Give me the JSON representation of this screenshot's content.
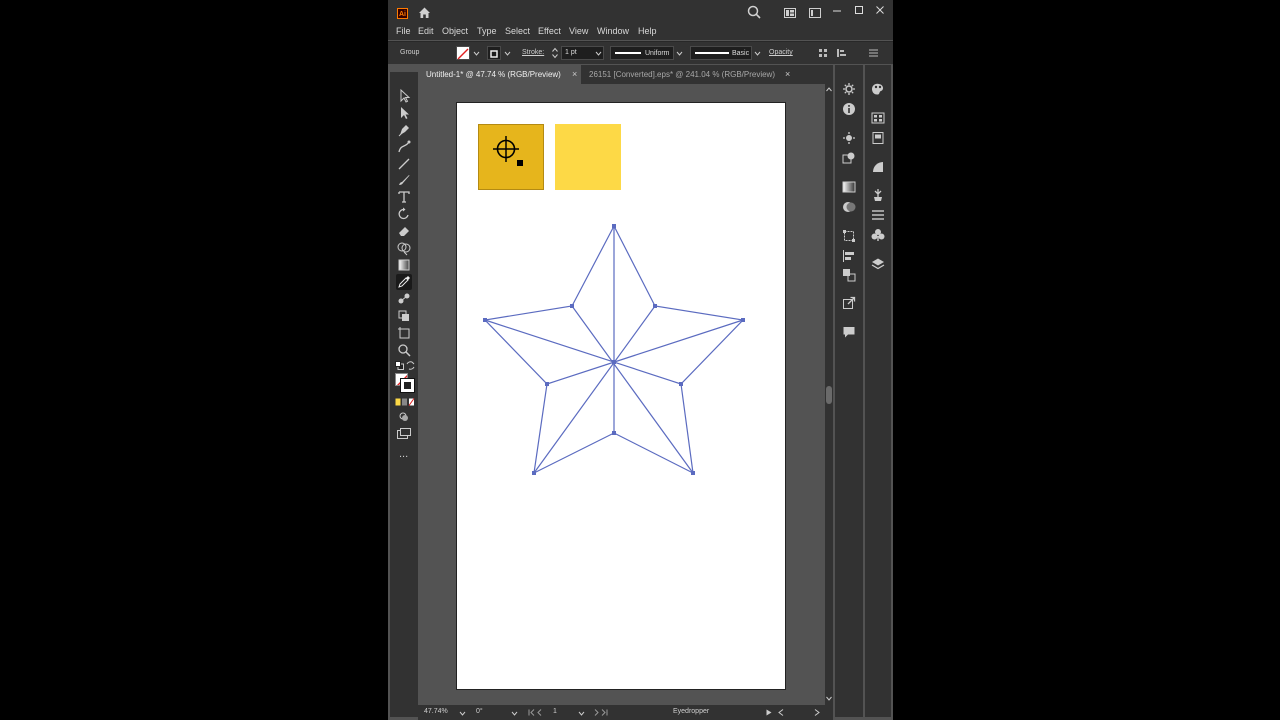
{
  "app": {
    "logo": "Ai"
  },
  "menu": [
    "File",
    "Edit",
    "Object",
    "Type",
    "Select",
    "Effect",
    "View",
    "Window",
    "Help"
  ],
  "control": {
    "selection": "Group",
    "stroke_label": "Stroke:",
    "stroke_weight": "1 pt",
    "profile": "Uniform",
    "brush": "Basic",
    "opacity_label": "Opacity"
  },
  "tabs": [
    {
      "label": "Untitled-1* @ 47.74 % (RGB/Preview)",
      "close": "×"
    },
    {
      "label": "26151 [Converted].eps* @ 241.04 % (RGB/Preview)",
      "close": "×"
    }
  ],
  "status": {
    "zoom": "47.74%",
    "rotation": "0°",
    "artboard": "1",
    "tool": "Eyedropper",
    "more": "..."
  },
  "colors": {
    "swatch_left": "#e6b51c",
    "swatch_right": "#fdd946",
    "path_selection": "#5b6bc0"
  }
}
